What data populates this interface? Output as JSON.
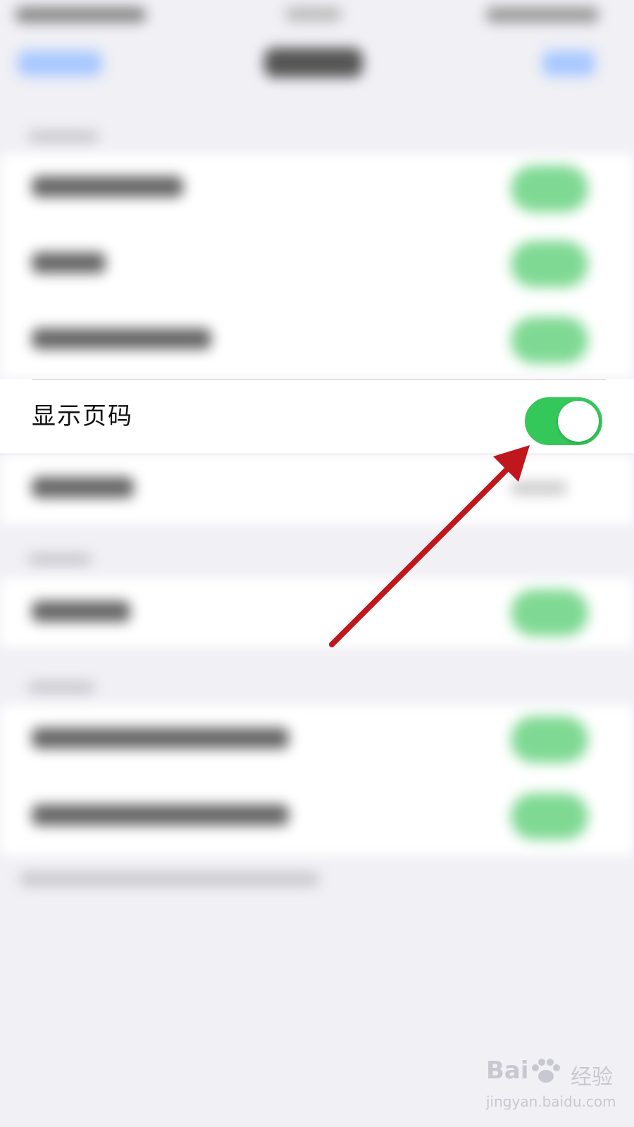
{
  "focused_row": {
    "label": "显示页码",
    "toggle_on": true,
    "toggle_color": "#34c759"
  },
  "annotation": {
    "arrow_color": "#c0171c",
    "points_to": "toggle"
  },
  "watermark": {
    "logo": "Bai",
    "brand": "经验",
    "url": "jingyan.baidu.com"
  }
}
